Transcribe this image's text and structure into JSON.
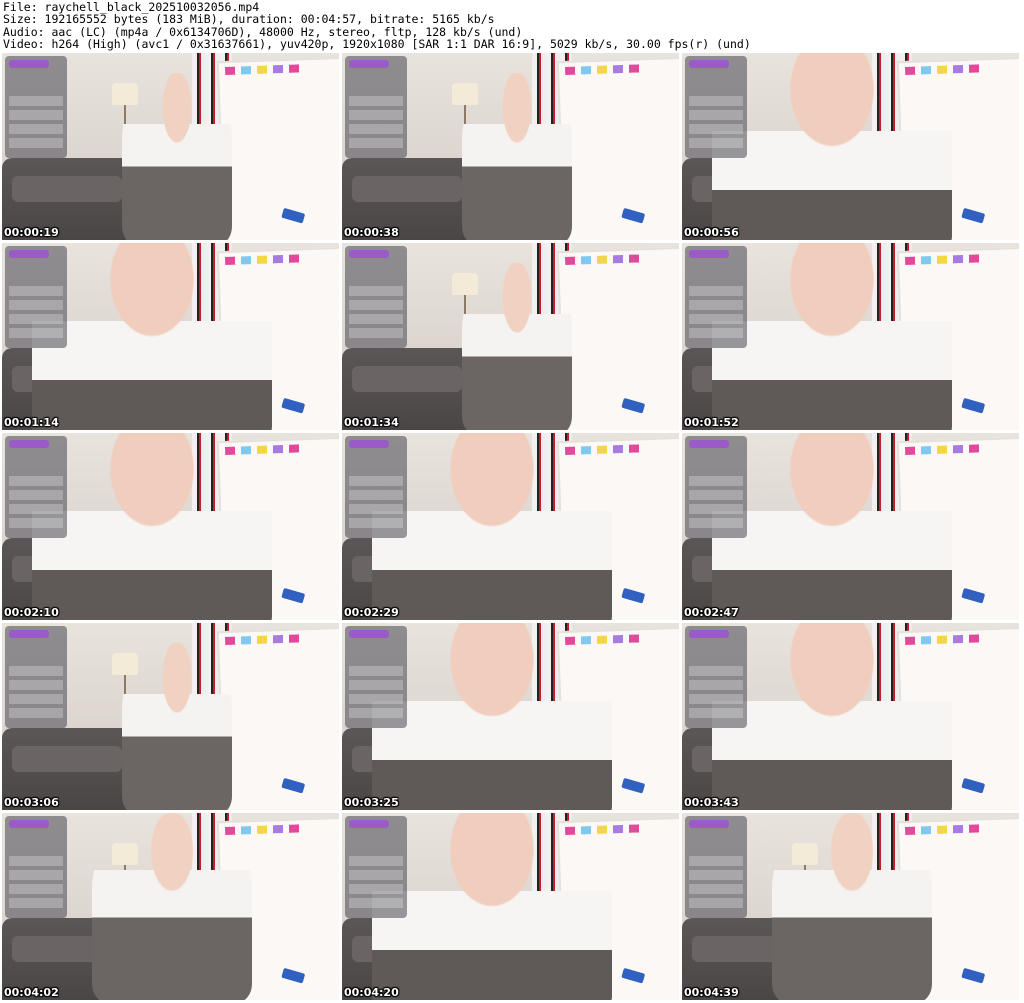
{
  "header": {
    "line1": "File: raychell_black_202510032056.mp4",
    "line2": "Size: 192165552 bytes (183 MiB), duration: 00:04:57, bitrate: 5165 kb/s",
    "line3": "Audio: aac (LC) (mp4a / 0x6134706D), 48000 Hz, stereo, fltp, 128 kb/s (und)",
    "line4": "Video: h264 (High) (avc1 / 0x31637661), yuv420p, 1920x1080 [SAR 1:1 DAR 16:9], 5029 kb/s, 30.00 fps(r) (und)"
  },
  "thumbnails": [
    {
      "time": "00:00:19",
      "shot": "wide"
    },
    {
      "time": "00:00:38",
      "shot": "wide"
    },
    {
      "time": "00:00:56",
      "shot": "close"
    },
    {
      "time": "00:01:14",
      "shot": "close"
    },
    {
      "time": "00:01:34",
      "shot": "wide"
    },
    {
      "time": "00:01:52",
      "shot": "close"
    },
    {
      "time": "00:02:10",
      "shot": "close"
    },
    {
      "time": "00:02:29",
      "shot": "close"
    },
    {
      "time": "00:02:47",
      "shot": "close"
    },
    {
      "time": "00:03:06",
      "shot": "wide"
    },
    {
      "time": "00:03:25",
      "shot": "close"
    },
    {
      "time": "00:03:43",
      "shot": "close"
    },
    {
      "time": "00:04:02",
      "shot": "mid"
    },
    {
      "time": "00:04:20",
      "shot": "close"
    },
    {
      "time": "00:04:39",
      "shot": "mid"
    }
  ]
}
